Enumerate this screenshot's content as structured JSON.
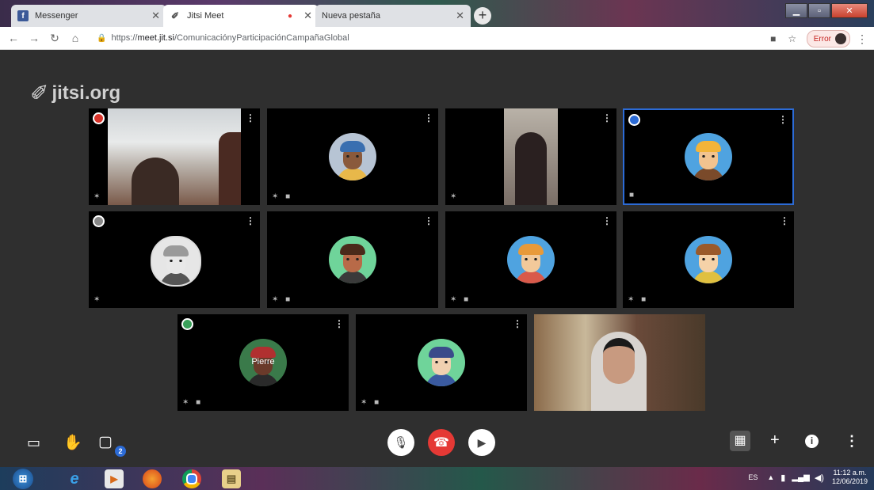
{
  "browser": {
    "tabs": [
      {
        "title": "Messenger",
        "icon": "facebook-icon",
        "active": false
      },
      {
        "title": "Jitsi Meet",
        "icon": "jitsi-icon",
        "active": true
      },
      {
        "title": "Nueva pestaña",
        "icon": "blank-icon",
        "active": false
      }
    ],
    "address": {
      "scheme": "https://",
      "host": "meet.jit.si",
      "path": "/ComunicaciónyParticipaciónCampañaGlobal"
    },
    "error_label": "Error"
  },
  "meeting": {
    "logo_text": "jitsi.org",
    "participants": [
      {
        "kind": "video",
        "badge": "red",
        "status": "muted"
      },
      {
        "kind": "avatar",
        "skin": "#8a5a3c",
        "hair": "#3a6fb0",
        "bg": "#b7c4d4",
        "shirt": "#e8b84a",
        "status": "muted-video-off"
      },
      {
        "kind": "video",
        "status": "muted"
      },
      {
        "kind": "avatar",
        "skin": "#f2c38f",
        "hair": "#f2b43a",
        "bg": "#4fa3e0",
        "shirt": "#7a4a2a",
        "status": "video-off",
        "active_speaker": true,
        "badge": "blue"
      },
      {
        "kind": "avatar",
        "skin": "#e8e8e8",
        "hair": "#9a9a9a",
        "bg": "#e6e6e6",
        "shirt": "#555555",
        "status": "muted",
        "badge": "gray",
        "grayscale": true
      },
      {
        "kind": "avatar",
        "skin": "#b86a48",
        "hair": "#4a2a1a",
        "bg": "#6fd49a",
        "shirt": "#3a3a3a",
        "status": "muted-video-off"
      },
      {
        "kind": "avatar",
        "skin": "#f2c99a",
        "hair": "#e89a3a",
        "bg": "#4fa3e0",
        "shirt": "#d95a4a",
        "status": "muted-video-off"
      },
      {
        "kind": "avatar",
        "skin": "#f5d2a8",
        "hair": "#9a5a2a",
        "bg": "#4fa3e0",
        "shirt": "#e0c040",
        "status": "muted-video-off"
      },
      {
        "kind": "avatar",
        "name": "Pierre",
        "skin": "#6a3a2a",
        "hair": "#b03030",
        "bg": "#3a7a4a",
        "shirt": "#2a2a2a",
        "status": "muted-video-off",
        "badge": "green"
      },
      {
        "kind": "avatar",
        "skin": "#f0d0b0",
        "hair": "#3a4a8a",
        "bg": "#6fd49a",
        "shirt": "#3a5aa0",
        "status": "muted-video-off"
      },
      {
        "kind": "video",
        "status": "none"
      }
    ],
    "chat_unread": "2"
  },
  "taskbar": {
    "language": "ES",
    "time": "11:12 a.m.",
    "date": "12/06/2019"
  },
  "colors": {
    "accent": "#2c6bd6",
    "hangup": "#e53935"
  }
}
